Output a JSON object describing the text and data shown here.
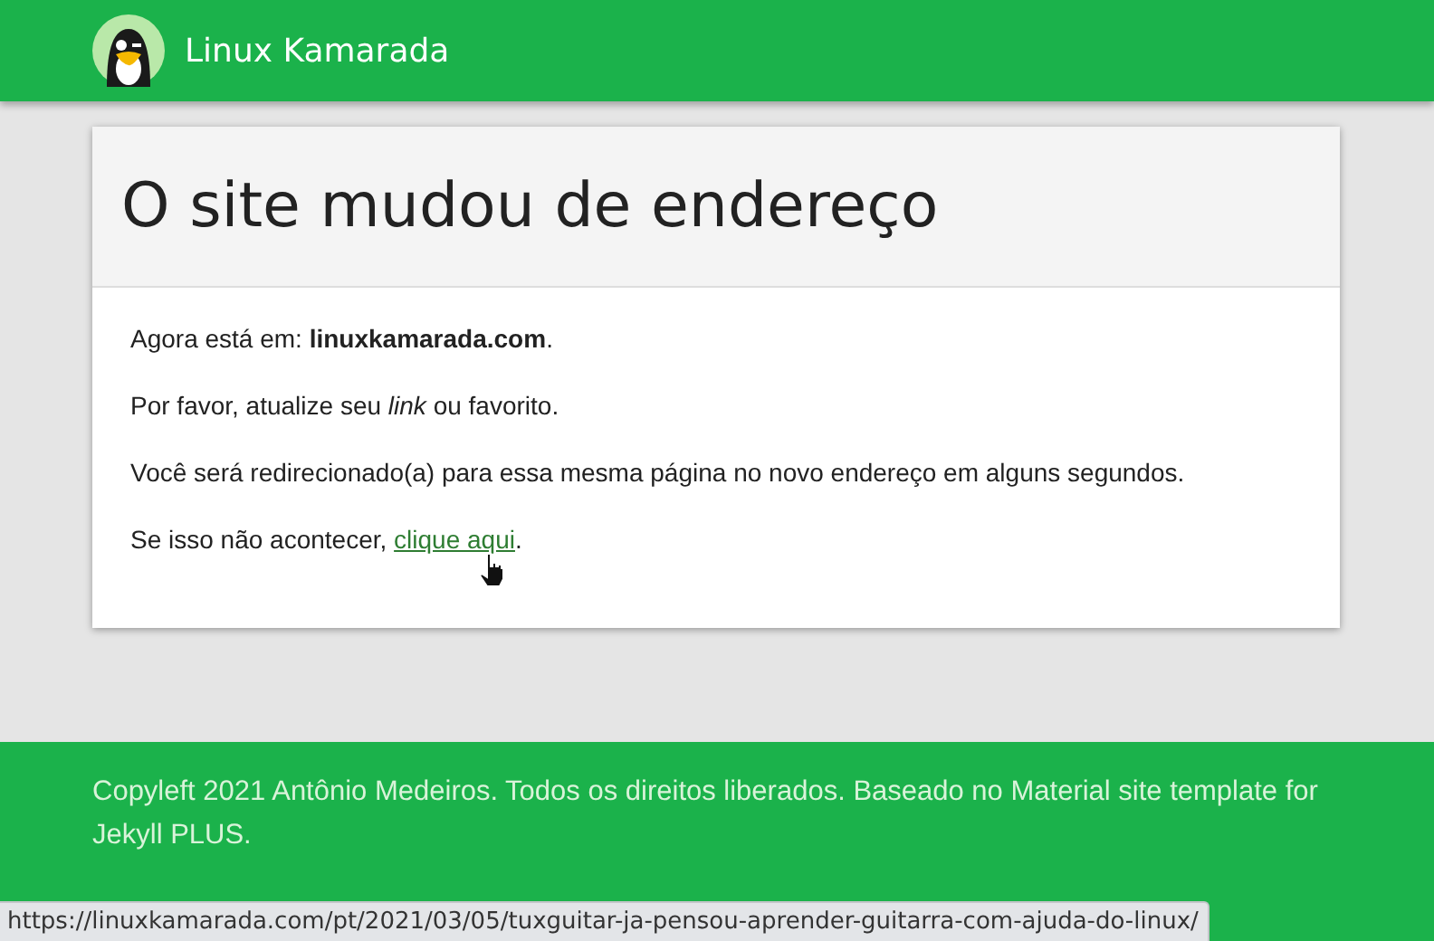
{
  "header": {
    "site_title": "Linux Kamarada"
  },
  "card": {
    "title": "O site mudou de endereço",
    "paragraphs": [
      "Agora está em: **linuxkamarada.com**.",
      "Por favor, atualize seu *link* ou favorito.",
      "Você será redirecionado(a) para essa mesma página no novo endereço em alguns segundos."
    ],
    "link_paragraph": {
      "before": "Se isso não acontecer, ",
      "link": "clique aqui",
      "after": "."
    }
  },
  "footer": {
    "text": "Copyleft 2021 Antônio Medeiros. Todos os direitos liberados. Baseado no Material site template for Jekyll PLUS."
  },
  "status_bar": {
    "url": "https://linuxkamarada.com/pt/2021/03/05/tuxguitar-ja-pensou-aprender-guitarra-com-ajuda-do-linux/"
  }
}
